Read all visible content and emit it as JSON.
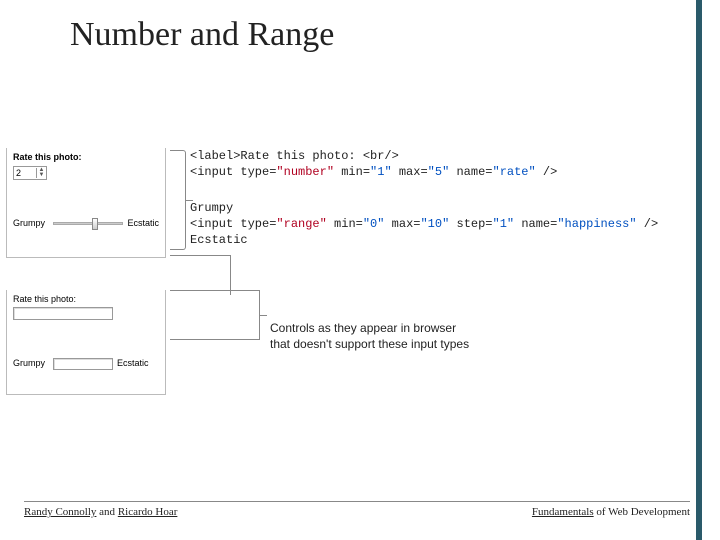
{
  "title": "Number and Range",
  "demo_top": {
    "label": "Rate this photo:",
    "number_value": "2",
    "slider_left": "Grumpy",
    "slider_right": "Ecstatic"
  },
  "code_block1": {
    "line1_a": "<label>Rate this photo: <br/>",
    "line2_a": "<input type=",
    "line2_b": "\"number\"",
    "line2_c": " min=",
    "line2_d": "\"1\"",
    "line2_e": " max=",
    "line2_f": "\"5\"",
    "line2_g": " name=",
    "line2_h": "\"rate\"",
    "line2_i": " />"
  },
  "code_block2": {
    "l1": "Grumpy",
    "l2_a": "<input type=",
    "l2_b": "\"range\"",
    "l2_c": " min=",
    "l2_d": "\"0\"",
    "l2_e": " max=",
    "l2_f": "\"10\"",
    "l2_g": " step=",
    "l2_h": "\"1\"",
    "l2_i": " name=",
    "l2_j": "\"happiness\"",
    "l2_k": " />",
    "l3": "Ecstatic"
  },
  "demo_bottom": {
    "label": "Rate this photo:",
    "left": "Grumpy",
    "right": "Ecstatic"
  },
  "caption": {
    "line1": "Controls as they appear in browser",
    "line2": "that doesn't support these input types"
  },
  "footer": {
    "left_a": "Randy Connolly",
    "left_b": " and ",
    "left_c": "Ricardo Hoar",
    "right_a": "Fundamentals",
    "right_b": " of Web Development"
  }
}
